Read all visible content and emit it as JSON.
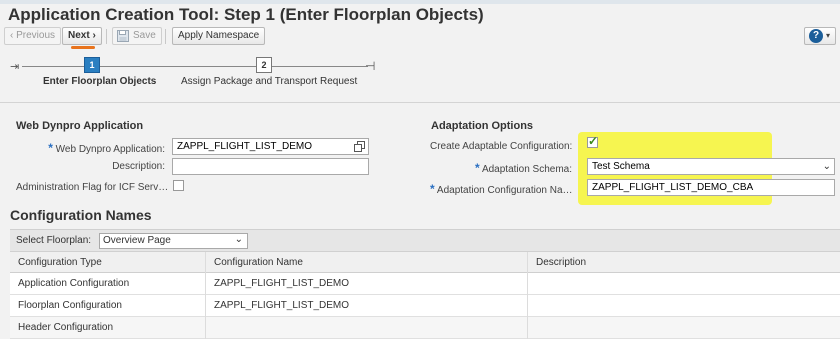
{
  "title": "Application Creation Tool: Step 1  (Enter Floorplan Objects)",
  "toolbar": {
    "previous": "‹ Previous",
    "next": "Next ›",
    "save": "Save",
    "apply_namespace": "Apply Namespace"
  },
  "roadmap": {
    "steps": [
      {
        "number": "1",
        "label": "Enter Floorplan Objects",
        "active": true
      },
      {
        "number": "2",
        "label": "Assign Package and Transport Request",
        "active": false
      }
    ]
  },
  "web_dynpro": {
    "title": "Web Dynpro Application",
    "app_label": "Web Dynpro Application:",
    "app_value": "ZAPPL_FLIGHT_LIST_DEMO",
    "description_label": "Description:",
    "description_value": "",
    "admin_flag_label": "Administration Flag for ICF Serv…",
    "admin_flag_checked": false
  },
  "adaptation": {
    "title": "Adaptation Options",
    "create_label": "Create Adaptable Configuration:",
    "create_checked": true,
    "schema_label": "Adaptation Schema:",
    "schema_value": "Test Schema",
    "config_label": "Adaptation Configuration Na…",
    "config_value": "ZAPPL_FLIGHT_LIST_DEMO_CBA"
  },
  "config_names": {
    "title": "Configuration Names",
    "select_label": "Select Floorplan:",
    "select_value": "Overview Page",
    "columns": [
      "Configuration Type",
      "Configuration Name",
      "Description"
    ],
    "rows": [
      [
        "Application Configuration",
        "ZAPPL_FLIGHT_LIST_DEMO",
        ""
      ],
      [
        "Floorplan Configuration",
        "ZAPPL_FLIGHT_LIST_DEMO",
        ""
      ],
      [
        "Header Configuration",
        "",
        ""
      ]
    ]
  },
  "colors": {
    "accent": "#2a7fc1",
    "highlight": "#f6f542",
    "orange_mark": "#e8731c"
  }
}
